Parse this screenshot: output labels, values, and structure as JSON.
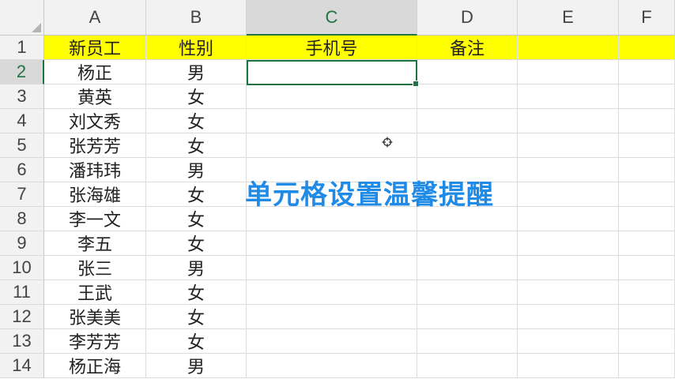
{
  "columns": [
    {
      "letter": "A"
    },
    {
      "letter": "B"
    },
    {
      "letter": "C"
    },
    {
      "letter": "D"
    },
    {
      "letter": "E"
    },
    {
      "letter": "F"
    }
  ],
  "selected_column": "C",
  "selected_row": 2,
  "header_row": [
    "新员工",
    "性别",
    "手机号",
    "备注"
  ],
  "rows": [
    {
      "num": "1"
    },
    {
      "num": "2",
      "name": "杨正",
      "gender": "男"
    },
    {
      "num": "3",
      "name": "黄英",
      "gender": "女"
    },
    {
      "num": "4",
      "name": "刘文秀",
      "gender": "女"
    },
    {
      "num": "5",
      "name": "张芳芳",
      "gender": "女"
    },
    {
      "num": "6",
      "name": "潘玮玮",
      "gender": "男"
    },
    {
      "num": "7",
      "name": "张海雄",
      "gender": "女"
    },
    {
      "num": "8",
      "name": "李一文",
      "gender": "女"
    },
    {
      "num": "9",
      "name": "李五",
      "gender": "女"
    },
    {
      "num": "10",
      "name": "张三",
      "gender": "男"
    },
    {
      "num": "11",
      "name": "王武",
      "gender": "女"
    },
    {
      "num": "12",
      "name": "张美美",
      "gender": "女"
    },
    {
      "num": "13",
      "name": "李芳芳",
      "gender": "女"
    },
    {
      "num": "14",
      "name": "杨正海",
      "gender": "男"
    }
  ],
  "caption": "单元格设置温馨提醒",
  "colors": {
    "header_fill": "#ffff00",
    "selection": "#217346",
    "caption": "#1f8be6"
  }
}
